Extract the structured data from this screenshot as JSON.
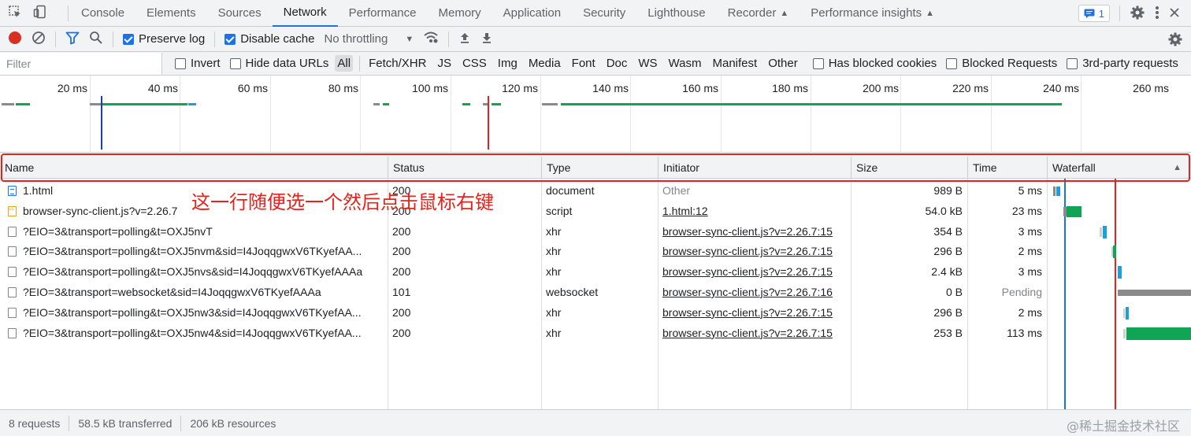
{
  "tabs": [
    {
      "label": "Console"
    },
    {
      "label": "Elements"
    },
    {
      "label": "Sources"
    },
    {
      "label": "Network",
      "active": true
    },
    {
      "label": "Performance"
    },
    {
      "label": "Memory"
    },
    {
      "label": "Application"
    },
    {
      "label": "Security"
    },
    {
      "label": "Lighthouse"
    },
    {
      "label": "Recorder"
    },
    {
      "label": "Performance insights"
    }
  ],
  "issues_count": "1",
  "toolbar": {
    "preserve_log": "Preserve log",
    "disable_cache": "Disable cache",
    "throttling": "No throttling"
  },
  "filter": {
    "placeholder": "Filter",
    "invert": "Invert",
    "hide_data_urls": "Hide data URLs",
    "types": [
      "All",
      "Fetch/XHR",
      "JS",
      "CSS",
      "Img",
      "Media",
      "Font",
      "Doc",
      "WS",
      "Wasm",
      "Manifest",
      "Other"
    ],
    "has_blocked_cookies": "Has blocked cookies",
    "blocked_requests": "Blocked Requests",
    "third_party": "3rd-party requests"
  },
  "overview": {
    "labels": [
      "20 ms",
      "40 ms",
      "60 ms",
      "80 ms",
      "100 ms",
      "120 ms",
      "140 ms",
      "160 ms",
      "180 ms",
      "200 ms",
      "220 ms",
      "240 ms",
      "260 ms"
    ]
  },
  "columns": {
    "name": "Name",
    "status": "Status",
    "type": "Type",
    "initiator": "Initiator",
    "size": "Size",
    "time": "Time",
    "waterfall": "Waterfall"
  },
  "rows": [
    {
      "name": "1.html",
      "status": "200",
      "type": "document",
      "initiator": "Other",
      "size": "989 B",
      "time": "5 ms",
      "icon": "doc"
    },
    {
      "name": "browser-sync-client.js?v=2.26.7",
      "status": "200",
      "type": "script",
      "initiator": "1.html:12",
      "size": "54.0 kB",
      "time": "23 ms",
      "icon": "js"
    },
    {
      "name": "?EIO=3&transport=polling&t=OXJ5nvT",
      "status": "200",
      "type": "xhr",
      "initiator": "browser-sync-client.js?v=2.26.7:15",
      "size": "354 B",
      "time": "3 ms",
      "icon": "plain"
    },
    {
      "name": "?EIO=3&transport=polling&t=OXJ5nvm&sid=I4JoqqgwxV6TKyefAA...",
      "status": "200",
      "type": "xhr",
      "initiator": "browser-sync-client.js?v=2.26.7:15",
      "size": "296 B",
      "time": "2 ms",
      "icon": "plain"
    },
    {
      "name": "?EIO=3&transport=polling&t=OXJ5nvs&sid=I4JoqqgwxV6TKyefAAAa",
      "status": "200",
      "type": "xhr",
      "initiator": "browser-sync-client.js?v=2.26.7:15",
      "size": "2.4 kB",
      "time": "3 ms",
      "icon": "plain"
    },
    {
      "name": "?EIO=3&transport=websocket&sid=I4JoqqgwxV6TKyefAAAa",
      "status": "101",
      "type": "websocket",
      "initiator": "browser-sync-client.js?v=2.26.7:16",
      "size": "0 B",
      "time": "Pending",
      "icon": "plain"
    },
    {
      "name": "?EIO=3&transport=polling&t=OXJ5nw3&sid=I4JoqqgwxV6TKyefAA...",
      "status": "200",
      "type": "xhr",
      "initiator": "browser-sync-client.js?v=2.26.7:15",
      "size": "296 B",
      "time": "2 ms",
      "icon": "plain"
    },
    {
      "name": "?EIO=3&transport=polling&t=OXJ5nw4&sid=I4JoqqgwxV6TKyefAA...",
      "status": "200",
      "type": "xhr",
      "initiator": "browser-sync-client.js?v=2.26.7:15",
      "size": "253 B",
      "time": "113 ms",
      "icon": "plain"
    }
  ],
  "annotation": "这一行随便选一个然后点击鼠标右键",
  "status": {
    "requests": "8 requests",
    "transferred": "58.5 kB transferred",
    "resources": "206 kB resources"
  },
  "watermark": "@稀土掘金技术社区",
  "colors": {
    "accent": "#1a73e8",
    "annotation_red": "#e8221b",
    "waterfall_green": "#0fa555",
    "waterfall_blue": "#1aa0e0",
    "waterfall_gray": "#8a8a8a"
  }
}
